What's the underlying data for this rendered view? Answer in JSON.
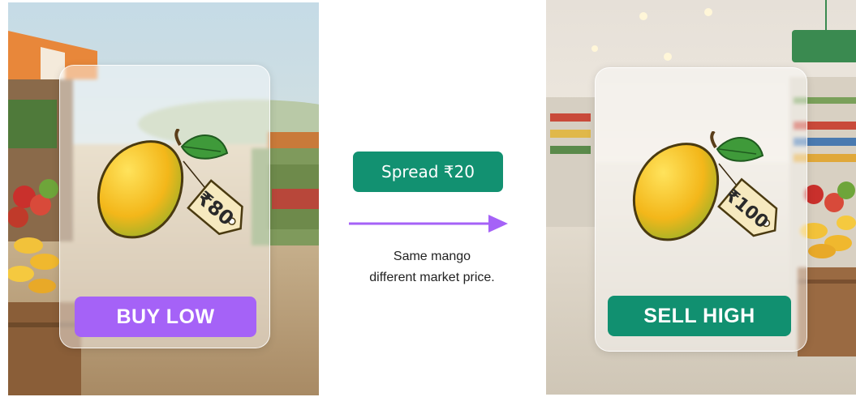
{
  "left": {
    "price_tag": "₹80",
    "button_label": "BUY LOW",
    "button_color": "#a562f7"
  },
  "right": {
    "price_tag": "₹100",
    "button_label": "SELL HIGH",
    "button_color": "#119070"
  },
  "center": {
    "spread_label": "Spread ₹20",
    "caption_line1": "Same mango",
    "caption_line2": "different market price.",
    "arrow_color": "#a562f7"
  }
}
